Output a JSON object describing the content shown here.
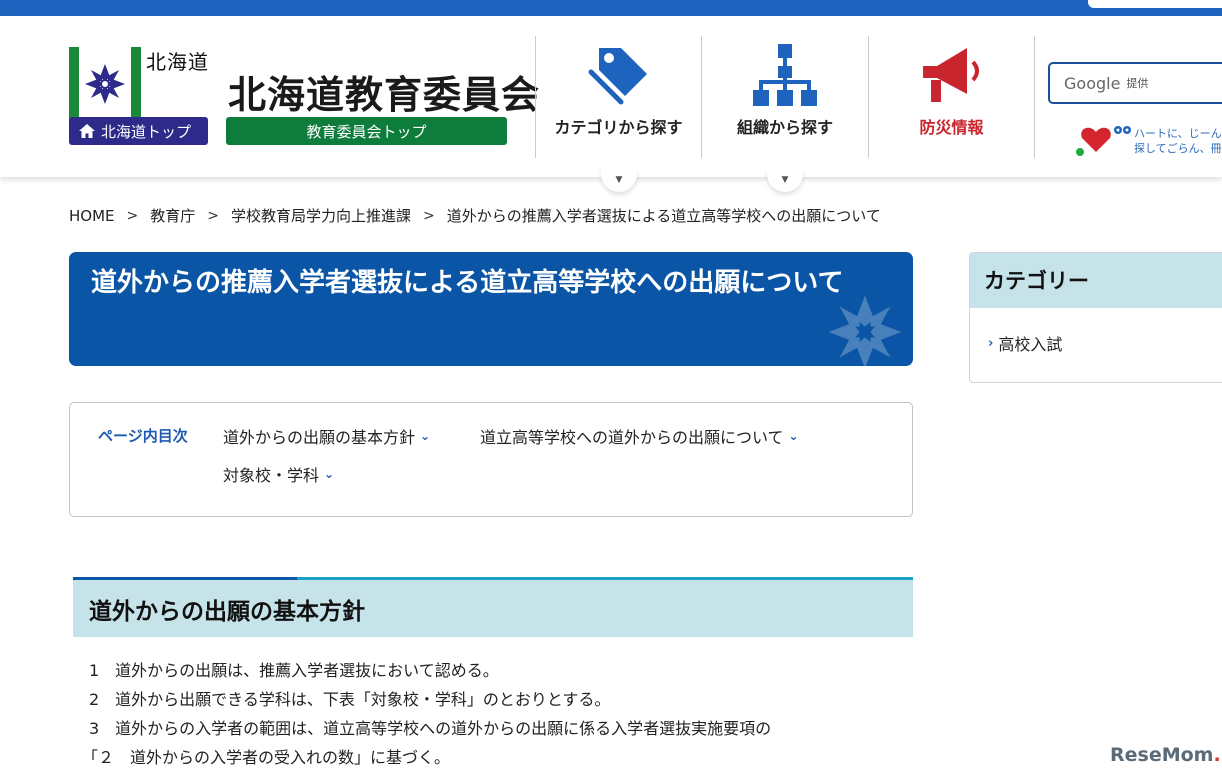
{
  "header": {
    "hokkaido_name": "北海道",
    "hokkaido_top_label": "北海道トップ",
    "board_title": "北海道教育委員会",
    "board_top_label": "教育委員会トップ",
    "nav": [
      {
        "label": "カテゴリから探す",
        "icon": "tag-icon",
        "color": "#1e64be"
      },
      {
        "label": "組織から探す",
        "icon": "org-chart-icon",
        "color": "#1e64be"
      },
      {
        "label": "防災情報",
        "icon": "megaphone-icon",
        "color": "#c9252e"
      }
    ],
    "search": {
      "brand": "Google",
      "suffix": "提供"
    },
    "banner_text_1": "ハートに、じーん",
    "banner_text_2": "探してごらん、冊"
  },
  "breadcrumb": [
    "HOME",
    "教育庁",
    "学校教育局学力向上推進課",
    "道外からの推薦入学者選抜による道立高等学校への出願について"
  ],
  "page_title": "道外からの推薦入学者選抜による道立高等学校への出願について",
  "toc": {
    "label": "ページ内目次",
    "links": [
      "道外からの出願の基本方針",
      "道立高等学校への道外からの出願について",
      "対象校・学科"
    ]
  },
  "section": {
    "heading": "道外からの出願の基本方針",
    "lines": [
      "1　道外からの出願は、推薦入学者選抜において認める。",
      "2　道外から出願できる学科は、下表「対象校・学科」のとおりとする。",
      "3　道外からの入学者の範囲は、道立高等学校への道外からの出願に係る入学者選抜実施要項の",
      "「２　道外からの入学者の受入れの数」に基づく。"
    ]
  },
  "sidebar": {
    "heading": "カテゴリー",
    "links": [
      "高校入試"
    ]
  },
  "watermark": {
    "part1": "Rese",
    "part2": "Mom",
    "dot": "."
  },
  "colors": {
    "primary_blue": "#0a55a5",
    "top_bar": "#1e64be",
    "green": "#0e7d3b",
    "navy": "#2d2a8a",
    "light_teal": "#c6e3ea",
    "alert_red": "#c9252e"
  }
}
